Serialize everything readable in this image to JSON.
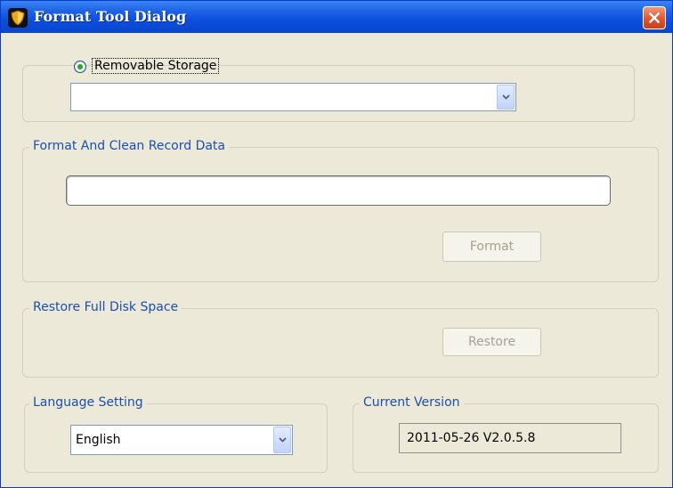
{
  "window": {
    "title": "Format Tool Dialog"
  },
  "storage": {
    "radio_label": "Removable Storage",
    "selected_device": ""
  },
  "format_group": {
    "legend": "Format And Clean Record Data",
    "path_value": "",
    "button_label": "Format"
  },
  "restore_group": {
    "legend": "Restore Full Disk Space",
    "button_label": "Restore"
  },
  "language_group": {
    "legend": "Language Setting",
    "selected_language": "English"
  },
  "version_group": {
    "legend": "Current Version",
    "value": "2011-05-26 V2.0.5.8"
  },
  "icons": {
    "app": "shield-icon",
    "close": "close-icon",
    "dropdown": "chevron-down-icon"
  },
  "colors": {
    "titlebar": "#0a46cf",
    "legend_text": "#1b4eb4",
    "dialog_bg": "#ece9d8",
    "close_button": "#e2532e"
  }
}
